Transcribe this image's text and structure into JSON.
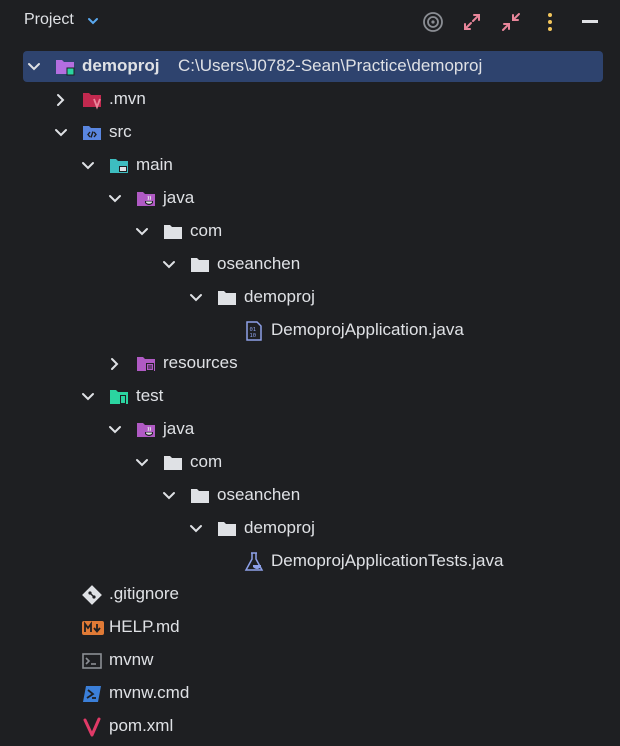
{
  "panel": {
    "title": "Project"
  },
  "toolbar": {
    "icons": [
      "target-icon",
      "expand-icon",
      "collapse-icon",
      "more-options-icon",
      "minimize-icon"
    ]
  },
  "tree": [
    {
      "label": "demoproj",
      "path": "C:\\Users\\J0782-Sean\\Practice\\demoproj",
      "icon": "module-folder-icon",
      "expanded": true,
      "selected": true
    },
    {
      "label": ".mvn",
      "icon": "maven-folder-icon",
      "expanded": false
    },
    {
      "label": "src",
      "icon": "source-folder-icon",
      "expanded": true
    },
    {
      "label": "main",
      "icon": "main-folder-icon",
      "expanded": true
    },
    {
      "label": "java",
      "icon": "java-source-folder-icon",
      "expanded": true
    },
    {
      "label": "com",
      "icon": "folder-icon",
      "expanded": true
    },
    {
      "label": "oseanchen",
      "icon": "folder-icon",
      "expanded": true
    },
    {
      "label": "demoproj",
      "icon": "folder-icon",
      "expanded": true
    },
    {
      "label": "DemoprojApplication.java",
      "icon": "java-class-file-icon"
    },
    {
      "label": "resources",
      "icon": "resources-folder-icon",
      "expanded": false
    },
    {
      "label": "test",
      "icon": "test-folder-icon",
      "expanded": true
    },
    {
      "label": "java",
      "icon": "java-test-folder-icon",
      "expanded": true
    },
    {
      "label": "com",
      "icon": "folder-icon",
      "expanded": true
    },
    {
      "label": "oseanchen",
      "icon": "folder-icon",
      "expanded": true
    },
    {
      "label": "demoproj",
      "icon": "folder-icon",
      "expanded": true
    },
    {
      "label": "DemoprojApplicationTests.java",
      "icon": "java-test-file-icon"
    },
    {
      "label": ".gitignore",
      "icon": "gitignore-icon"
    },
    {
      "label": "HELP.md",
      "icon": "markdown-icon"
    },
    {
      "label": "mvnw",
      "icon": "shell-script-icon"
    },
    {
      "label": "mvnw.cmd",
      "icon": "powershell-icon"
    },
    {
      "label": "pom.xml",
      "icon": "maven-pom-icon"
    }
  ],
  "colors": {
    "background": "#1e1f22",
    "selection": "#2e436e",
    "text": "#dfe1e5",
    "folder": "#dfe1e5",
    "java_folder": "#b05ac4",
    "test_folder": "#2bd4a0",
    "main_folder": "#3dbdc0",
    "accent_pink": "#e9869b",
    "accent_yellow": "#f2c55c"
  }
}
